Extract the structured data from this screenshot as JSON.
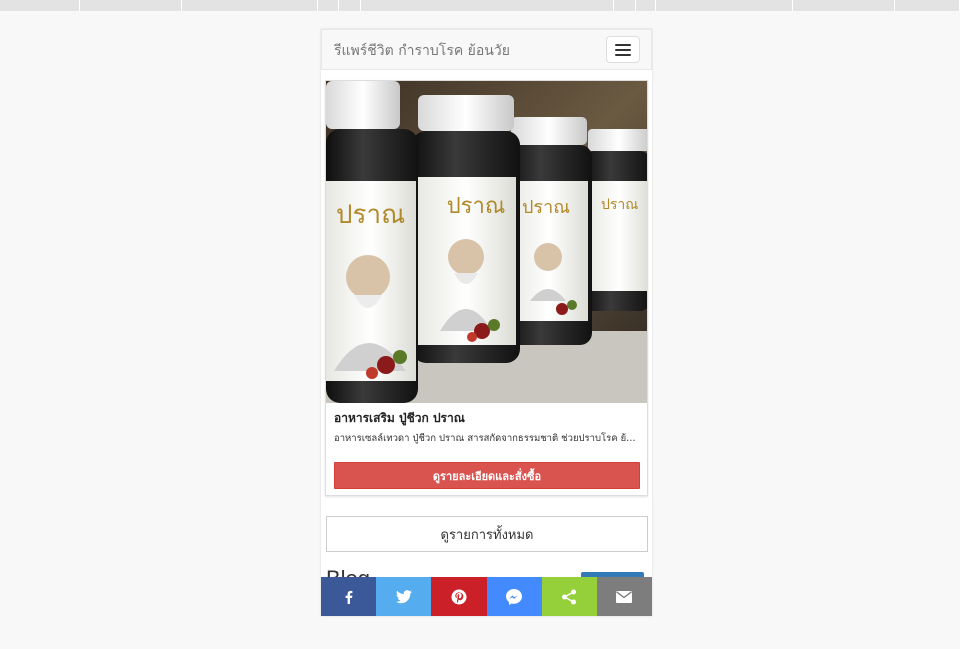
{
  "navbar": {
    "brand": "รีแพร์ชีวิต กำราบโรค ย้อนวัย"
  },
  "product": {
    "image_label": "ปราณ",
    "title": "อาหารเสริม ปู่ชีวก ปราณ",
    "description": "อาหารเซลล์เทวดา ปู่ชีวก ปราณ สารสกัดจากธรรมชาติ ช่วยปราบโรค ย้อนวัย ...",
    "order_label": "ดูรายละเอียดและสั่งซื้อ"
  },
  "view_all_label": "ดูรายการทั้งหมด",
  "blog_heading": "Blog",
  "share": [
    {
      "icon": "facebook-icon",
      "color": "#3b5998"
    },
    {
      "icon": "twitter-icon",
      "color": "#55acee"
    },
    {
      "icon": "pinterest-icon",
      "color": "#cb2027"
    },
    {
      "icon": "messenger-icon",
      "color": "#448aff"
    },
    {
      "icon": "share-icon",
      "color": "#95d03a"
    },
    {
      "icon": "email-icon",
      "color": "#7d7d7d"
    }
  ],
  "colors": {
    "order_button": "#d9534f",
    "blog_more_button": "#337ab7"
  }
}
